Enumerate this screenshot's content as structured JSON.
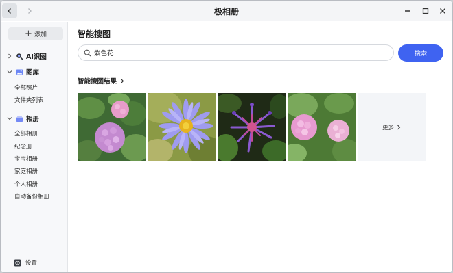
{
  "window": {
    "title": "极相册"
  },
  "sidebar": {
    "add_label": "添加",
    "groups": [
      {
        "label": "AI识图",
        "icon": "ai-search-icon",
        "expanded": false,
        "items": []
      },
      {
        "label": "图库",
        "icon": "gallery-icon",
        "expanded": true,
        "items": [
          "全部照片",
          "文件夹列表"
        ]
      },
      {
        "label": "相册",
        "icon": "album-icon",
        "expanded": true,
        "items": [
          "全部相册",
          "纪念册",
          "宝宝相册",
          "家庭相册",
          "个人相册",
          "自动备份相册"
        ]
      }
    ],
    "settings_label": "设置"
  },
  "main": {
    "page_title": "智能搜图",
    "search": {
      "value": "紫色花",
      "placeholder": "",
      "button_label": "搜索"
    },
    "results_title": "智能搜图结果",
    "results": [
      {
        "subject": "pink-hydrangea"
      },
      {
        "subject": "purple-aster"
      },
      {
        "subject": "purple-spider-flower"
      },
      {
        "subject": "pink-hydrangea-leaves"
      }
    ],
    "more_label": "更多"
  },
  "colors": {
    "accent": "#3f63f1",
    "sidebar_bg": "#f7f8fa",
    "titlebar_bg": "#f4f5f7"
  }
}
